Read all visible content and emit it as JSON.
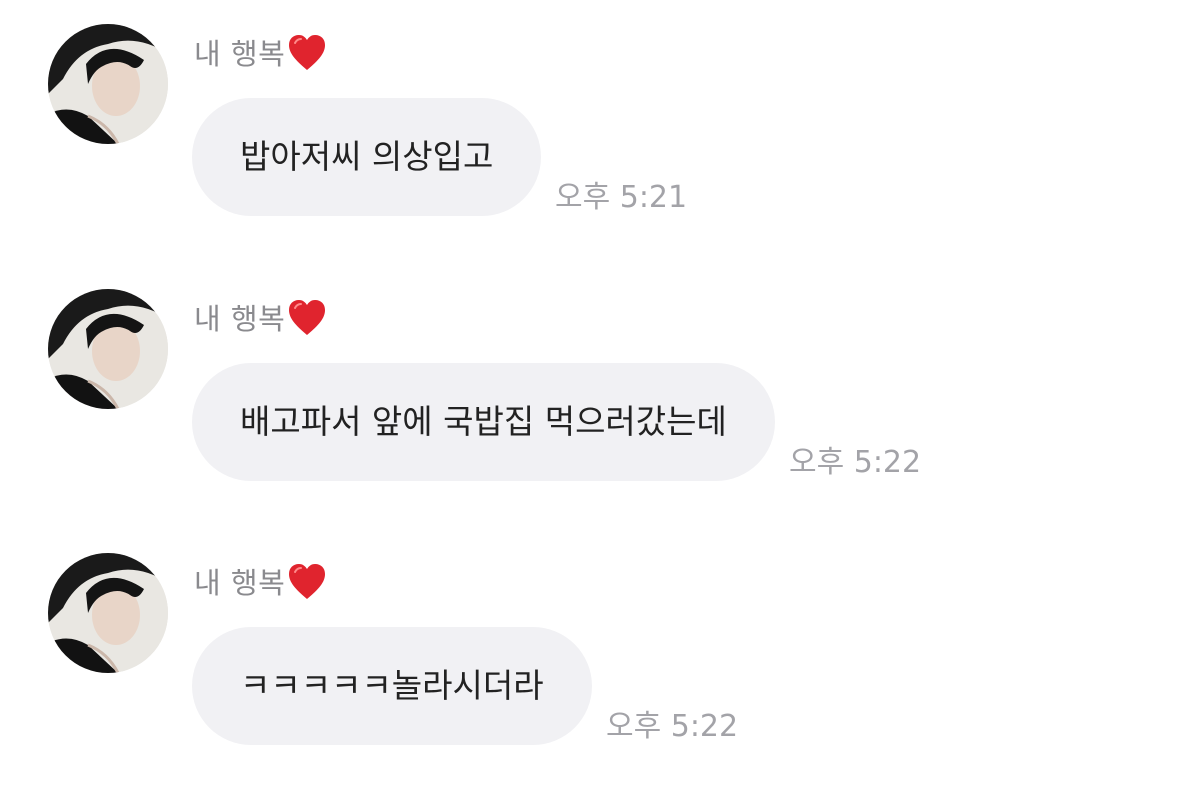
{
  "messages": [
    {
      "sender": "내 행복",
      "sender_emoji": "heart-red",
      "text": "밥아저씨 의상입고",
      "time": "오후 5:21"
    },
    {
      "sender": "내 행복",
      "sender_emoji": "heart-red",
      "text": "배고파서 앞에 국밥집 먹으러갔는데",
      "time": "오후 5:22"
    },
    {
      "sender": "내 행복",
      "sender_emoji": "heart-red",
      "text": "ㅋㅋㅋㅋㅋ놀라시더라",
      "time": "오후 5:22"
    }
  ],
  "colors": {
    "bubble_bg": "#f1f1f4",
    "sender_text": "#8a8a8e",
    "time_text": "#a3a3a8",
    "message_text": "#222222",
    "heart": "#e0242e"
  }
}
